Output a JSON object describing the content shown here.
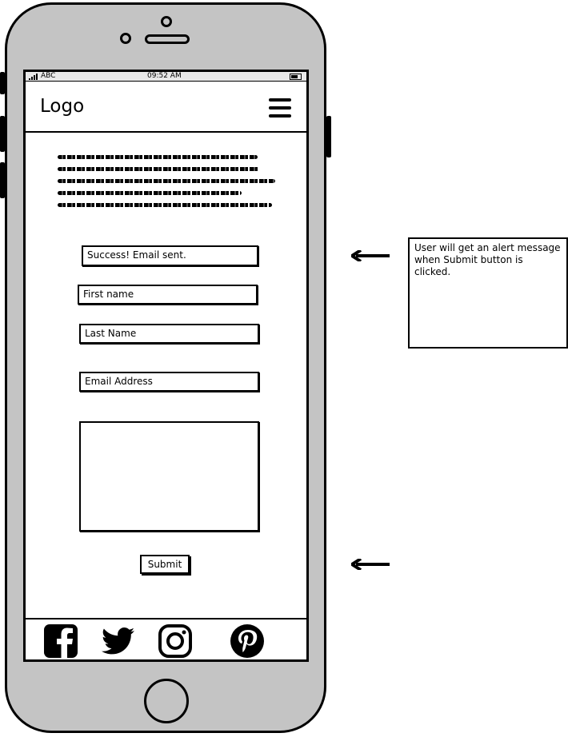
{
  "status_bar": {
    "carrier": "ABC",
    "time": "09:52 AM"
  },
  "header": {
    "logo": "Logo"
  },
  "form": {
    "alert_text": "Success! Email sent.",
    "first_name_placeholder": "First name",
    "last_name_placeholder": "Last Name",
    "email_placeholder": "Email Address",
    "message_value": "",
    "submit_label": "Submit"
  },
  "social_icons": [
    "facebook-icon",
    "twitter-icon",
    "instagram-icon",
    "pinterest-icon"
  ],
  "annotation": {
    "note": "User will get an alert message when  Submit button is clicked."
  },
  "colors": {
    "device": "#c4c4c4",
    "outline": "#000000"
  }
}
